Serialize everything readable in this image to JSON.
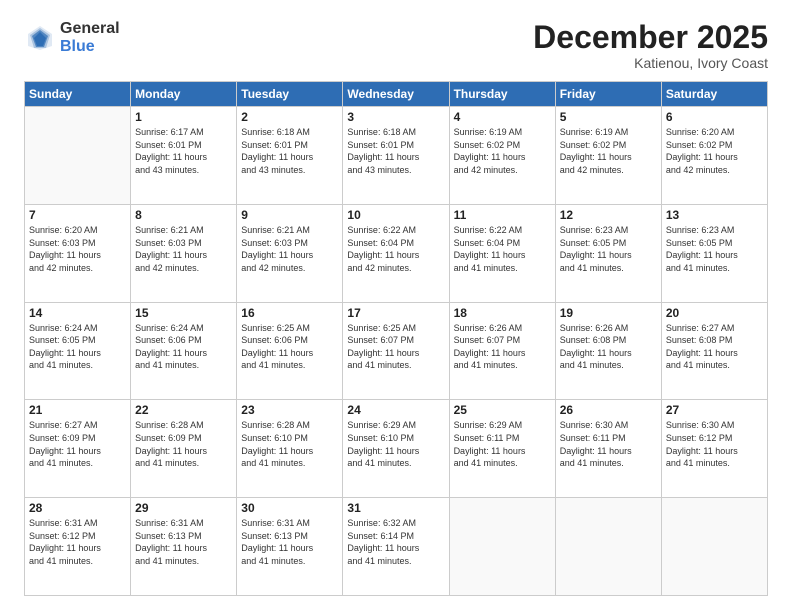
{
  "header": {
    "logo_general": "General",
    "logo_blue": "Blue",
    "month_title": "December 2025",
    "subtitle": "Katienou, Ivory Coast"
  },
  "days_of_week": [
    "Sunday",
    "Monday",
    "Tuesday",
    "Wednesday",
    "Thursday",
    "Friday",
    "Saturday"
  ],
  "weeks": [
    [
      {
        "day": "",
        "info": ""
      },
      {
        "day": "1",
        "info": "Sunrise: 6:17 AM\nSunset: 6:01 PM\nDaylight: 11 hours\nand 43 minutes."
      },
      {
        "day": "2",
        "info": "Sunrise: 6:18 AM\nSunset: 6:01 PM\nDaylight: 11 hours\nand 43 minutes."
      },
      {
        "day": "3",
        "info": "Sunrise: 6:18 AM\nSunset: 6:01 PM\nDaylight: 11 hours\nand 43 minutes."
      },
      {
        "day": "4",
        "info": "Sunrise: 6:19 AM\nSunset: 6:02 PM\nDaylight: 11 hours\nand 42 minutes."
      },
      {
        "day": "5",
        "info": "Sunrise: 6:19 AM\nSunset: 6:02 PM\nDaylight: 11 hours\nand 42 minutes."
      },
      {
        "day": "6",
        "info": "Sunrise: 6:20 AM\nSunset: 6:02 PM\nDaylight: 11 hours\nand 42 minutes."
      }
    ],
    [
      {
        "day": "7",
        "info": "Sunrise: 6:20 AM\nSunset: 6:03 PM\nDaylight: 11 hours\nand 42 minutes."
      },
      {
        "day": "8",
        "info": "Sunrise: 6:21 AM\nSunset: 6:03 PM\nDaylight: 11 hours\nand 42 minutes."
      },
      {
        "day": "9",
        "info": "Sunrise: 6:21 AM\nSunset: 6:03 PM\nDaylight: 11 hours\nand 42 minutes."
      },
      {
        "day": "10",
        "info": "Sunrise: 6:22 AM\nSunset: 6:04 PM\nDaylight: 11 hours\nand 42 minutes."
      },
      {
        "day": "11",
        "info": "Sunrise: 6:22 AM\nSunset: 6:04 PM\nDaylight: 11 hours\nand 41 minutes."
      },
      {
        "day": "12",
        "info": "Sunrise: 6:23 AM\nSunset: 6:05 PM\nDaylight: 11 hours\nand 41 minutes."
      },
      {
        "day": "13",
        "info": "Sunrise: 6:23 AM\nSunset: 6:05 PM\nDaylight: 11 hours\nand 41 minutes."
      }
    ],
    [
      {
        "day": "14",
        "info": "Sunrise: 6:24 AM\nSunset: 6:05 PM\nDaylight: 11 hours\nand 41 minutes."
      },
      {
        "day": "15",
        "info": "Sunrise: 6:24 AM\nSunset: 6:06 PM\nDaylight: 11 hours\nand 41 minutes."
      },
      {
        "day": "16",
        "info": "Sunrise: 6:25 AM\nSunset: 6:06 PM\nDaylight: 11 hours\nand 41 minutes."
      },
      {
        "day": "17",
        "info": "Sunrise: 6:25 AM\nSunset: 6:07 PM\nDaylight: 11 hours\nand 41 minutes."
      },
      {
        "day": "18",
        "info": "Sunrise: 6:26 AM\nSunset: 6:07 PM\nDaylight: 11 hours\nand 41 minutes."
      },
      {
        "day": "19",
        "info": "Sunrise: 6:26 AM\nSunset: 6:08 PM\nDaylight: 11 hours\nand 41 minutes."
      },
      {
        "day": "20",
        "info": "Sunrise: 6:27 AM\nSunset: 6:08 PM\nDaylight: 11 hours\nand 41 minutes."
      }
    ],
    [
      {
        "day": "21",
        "info": "Sunrise: 6:27 AM\nSunset: 6:09 PM\nDaylight: 11 hours\nand 41 minutes."
      },
      {
        "day": "22",
        "info": "Sunrise: 6:28 AM\nSunset: 6:09 PM\nDaylight: 11 hours\nand 41 minutes."
      },
      {
        "day": "23",
        "info": "Sunrise: 6:28 AM\nSunset: 6:10 PM\nDaylight: 11 hours\nand 41 minutes."
      },
      {
        "day": "24",
        "info": "Sunrise: 6:29 AM\nSunset: 6:10 PM\nDaylight: 11 hours\nand 41 minutes."
      },
      {
        "day": "25",
        "info": "Sunrise: 6:29 AM\nSunset: 6:11 PM\nDaylight: 11 hours\nand 41 minutes."
      },
      {
        "day": "26",
        "info": "Sunrise: 6:30 AM\nSunset: 6:11 PM\nDaylight: 11 hours\nand 41 minutes."
      },
      {
        "day": "27",
        "info": "Sunrise: 6:30 AM\nSunset: 6:12 PM\nDaylight: 11 hours\nand 41 minutes."
      }
    ],
    [
      {
        "day": "28",
        "info": "Sunrise: 6:31 AM\nSunset: 6:12 PM\nDaylight: 11 hours\nand 41 minutes."
      },
      {
        "day": "29",
        "info": "Sunrise: 6:31 AM\nSunset: 6:13 PM\nDaylight: 11 hours\nand 41 minutes."
      },
      {
        "day": "30",
        "info": "Sunrise: 6:31 AM\nSunset: 6:13 PM\nDaylight: 11 hours\nand 41 minutes."
      },
      {
        "day": "31",
        "info": "Sunrise: 6:32 AM\nSunset: 6:14 PM\nDaylight: 11 hours\nand 41 minutes."
      },
      {
        "day": "",
        "info": ""
      },
      {
        "day": "",
        "info": ""
      },
      {
        "day": "",
        "info": ""
      }
    ]
  ]
}
